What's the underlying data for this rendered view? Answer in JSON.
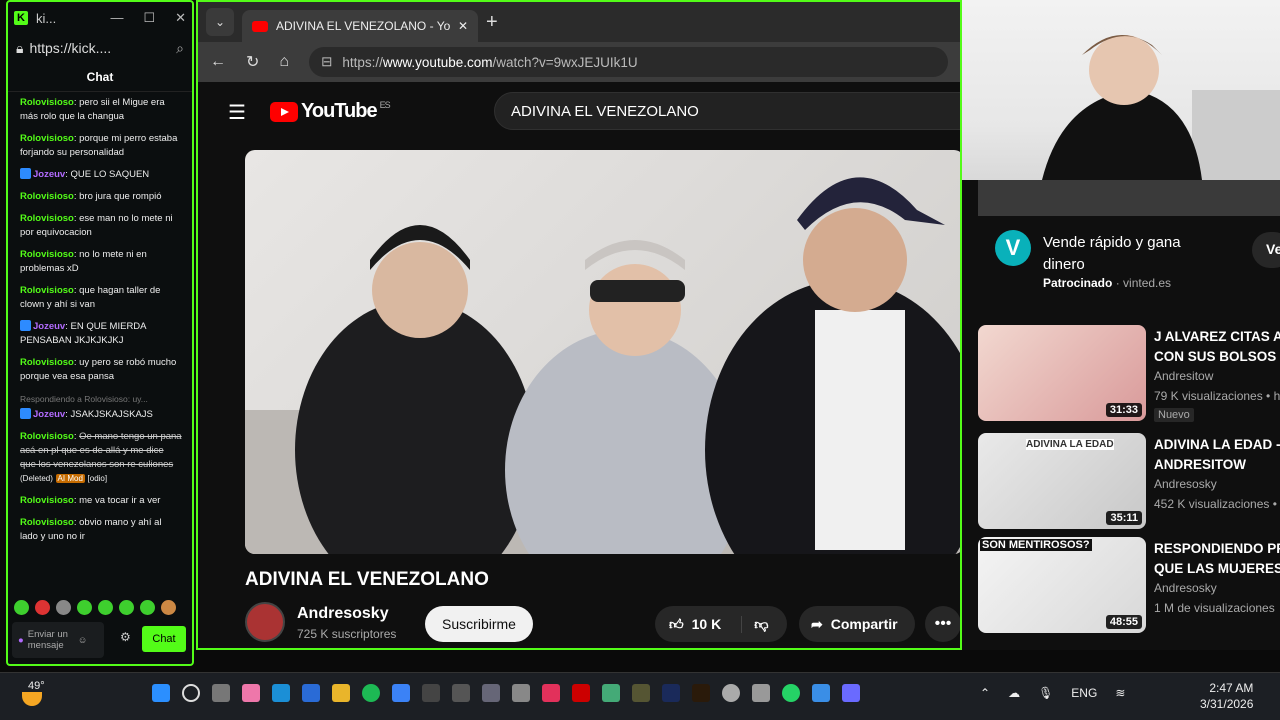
{
  "kick": {
    "title": "ki...",
    "url": "https://kick....",
    "chat_header": "Chat",
    "messages": [
      {
        "user": "Rolovisioso",
        "text": "pero sii el Migue era más rolo que la changua",
        "color": "green"
      },
      {
        "user": "Rolovisioso",
        "text": "porque mi perro estaba forjando su personalidad",
        "color": "green"
      },
      {
        "user": "Jozeuv",
        "text": "QUE LO SAQUEN",
        "color": "purple"
      },
      {
        "user": "Rolovisioso",
        "text": "bro jura que rompió",
        "color": "green"
      },
      {
        "user": "Rolovisioso",
        "text": "ese man no lo mete ni por equivocacion",
        "color": "green"
      },
      {
        "user": "Rolovisioso",
        "text": "no lo mete ni en problemas xD",
        "color": "green"
      },
      {
        "user": "Rolovisioso",
        "text": "que hagan taller de clown y ahí si van",
        "color": "green"
      },
      {
        "user": "Jozeuv",
        "text": "EN QUE MIERDA PENSABAN JKJKJKJKJ",
        "color": "purple"
      },
      {
        "user": "Rolovisioso",
        "text": "uy pero se robó mucho porque vea esa pansa",
        "color": "green"
      },
      {
        "user": "Jozeuv",
        "text": "JSAKJSKAJSKAJS",
        "color": "purple"
      },
      {
        "user": "Rolovisioso",
        "text": "me va tocar ir a ver",
        "color": "green"
      },
      {
        "user": "Rolovisioso",
        "text": "obvio mano y ahí al lado y uno no ir",
        "color": "green"
      }
    ],
    "reply_label": "Respondiendo a Rolovisioso: uy...",
    "deleted_msg": {
      "user": "Rolovisioso",
      "text": "Oe mano tengo un pana acá en pl que es de allá y me dice que los venezolanos son re culiones",
      "deleted": "(Deleted)",
      "mod": "AI Mod",
      "tag": "[odio]"
    },
    "input_placeholder": "Enviar un mensaje",
    "chat_button": "Chat"
  },
  "browser": {
    "tab_title": "ADIVINA EL VENEZOLANO - YouTu",
    "url_prefix": "https://",
    "url_domain": "www.youtube.com",
    "url_path": "/watch?v=9wxJEJUIk1U"
  },
  "youtube": {
    "logo": "YouTube",
    "region": "ES",
    "search_value": "ADIVINA EL VENEZOLANO",
    "video_title": "ADIVINA EL VENEZOLANO",
    "channel": "Andresosky",
    "subscribers": "725 K suscriptores",
    "subscribe_label": "Suscribirme",
    "likes": "10 K",
    "share_label": "Compartir"
  },
  "sidebar": {
    "ad": {
      "title": "Vende rápido y gana dinero",
      "sponsored": "Patrocinado",
      "domain": "vinted.es",
      "cta": "Ve"
    },
    "recs": [
      {
        "title": "J ALVAREZ CITAS A CON SUS BOLSOS",
        "channel": "Andresitow",
        "views": "79 K visualizaciones • h",
        "duration": "31:33",
        "badge": "Nuevo"
      },
      {
        "title": "ADIVINA LA EDAD - ANDRESITOW",
        "channel": "Andresosky",
        "views": "452 K visualizaciones •",
        "duration": "35:11",
        "thumb_text": "ADIVINA LA EDAD"
      },
      {
        "title": "RESPONDIENDO PR QUE LAS MUJERES",
        "channel": "Andresosky",
        "views": "1 M de visualizaciones",
        "duration": "48:55",
        "thumb_text": "SON MENTIROSOS?"
      }
    ]
  },
  "taskbar": {
    "temp": "49°",
    "lang": "ENG",
    "time": "2:47 AM",
    "date": "3/31/2026"
  }
}
